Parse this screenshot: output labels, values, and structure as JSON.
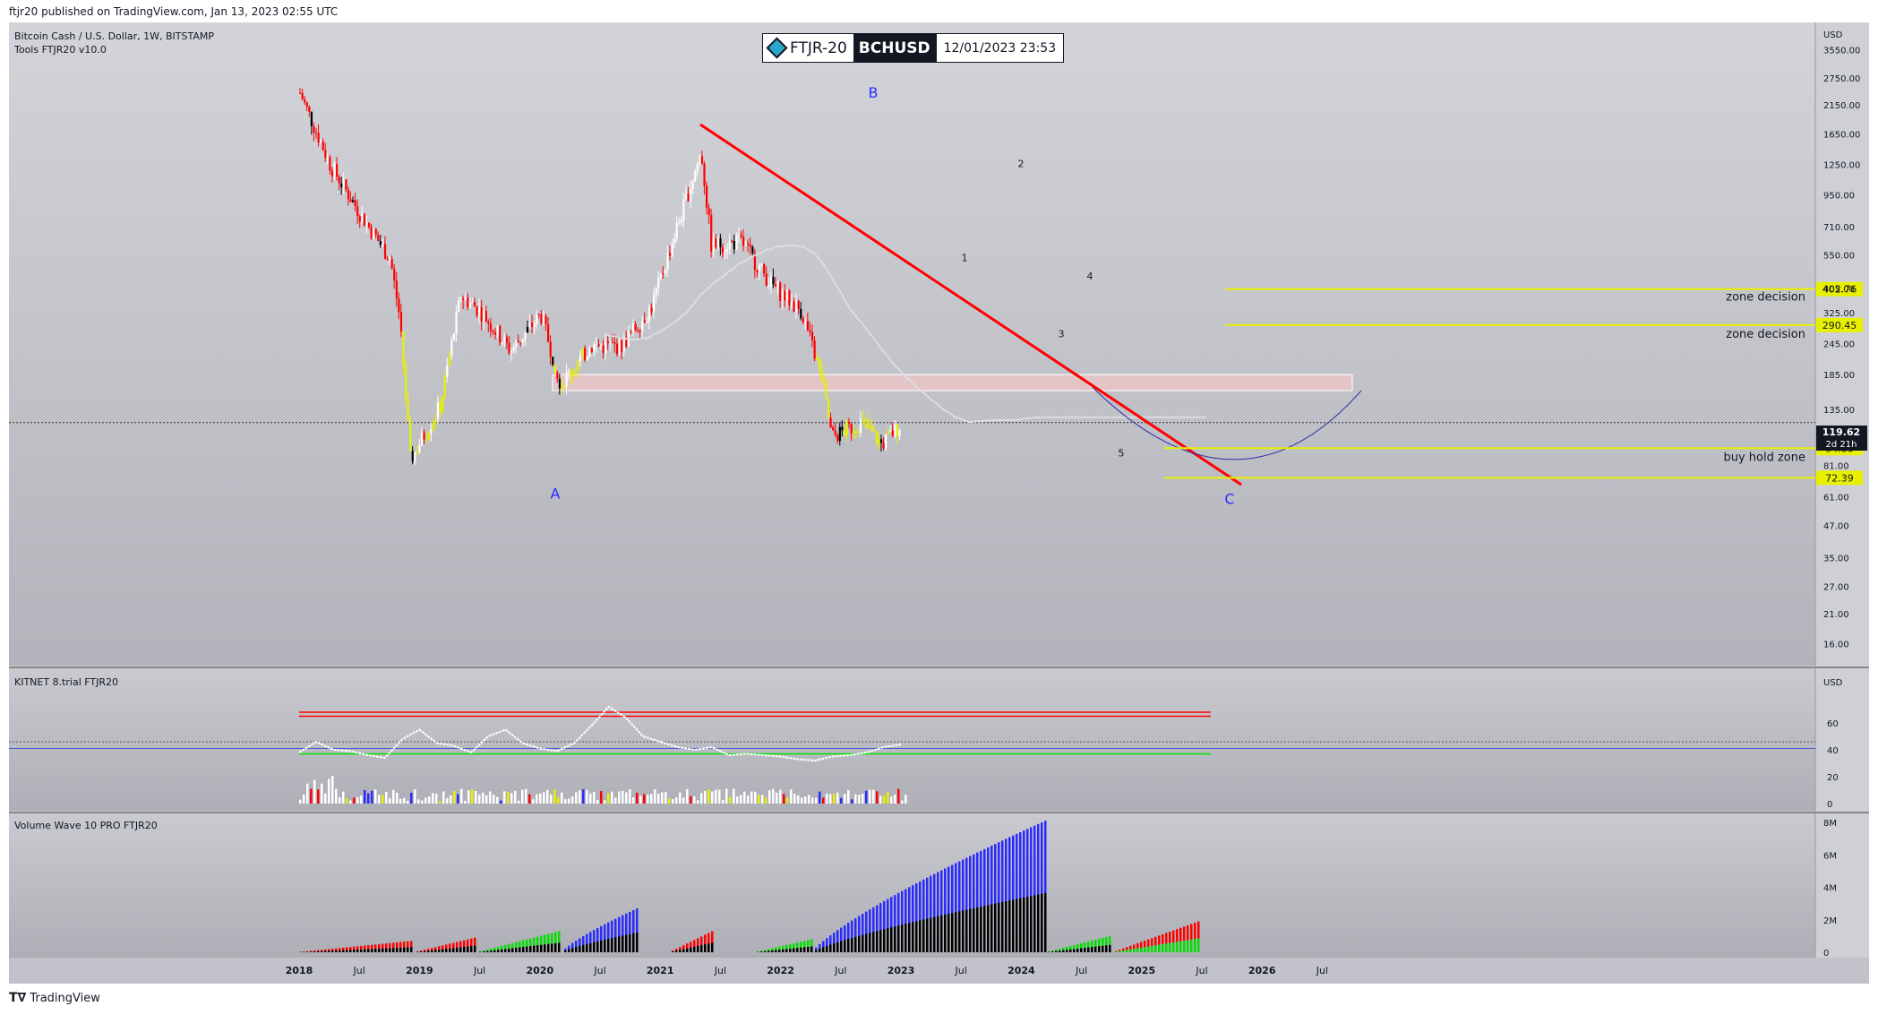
{
  "publish_line": "ftjr20 published on TradingView.com, Jan 13, 2023 02:55 UTC",
  "footer_brand": "TradingView",
  "badge": {
    "brand": "FTJR-20",
    "symbol": "BCHUSD",
    "datetime": "12/01/2023 23:53"
  },
  "main_pane": {
    "title_line1": "Bitcoin Cash / U.S. Dollar, 1W, BITSTAMP",
    "title_line2": "Tools  FTJR20  v10.0",
    "axis_currency": "USD",
    "price_tag": "119.62",
    "countdown": "2d 21h"
  },
  "osc_pane": {
    "title": "KITNET  8.trial  FTJR20",
    "axis_currency": "USD"
  },
  "vol_pane": {
    "title": "Volume Wave 10 PRO FTJR20"
  },
  "colors": {
    "bull": "#ffffff",
    "bear": "#ff0000",
    "yellow": "#e8f000",
    "blue": "#2a2aff",
    "green": "#00e000",
    "black": "#000000",
    "ma": "#dcdcdc",
    "trend": "#ff0000",
    "arc": "#2a2aaa"
  },
  "chart_data": [
    {
      "type": "candlestick",
      "scale": "log",
      "ylim": [
        14,
        4200
      ],
      "x_ticks": [
        "2018",
        "Jul",
        "2019",
        "Jul",
        "2020",
        "Jul",
        "2021",
        "Jul",
        "2022",
        "Jul",
        "2023",
        "Jul",
        "2024",
        "Jul",
        "2025",
        "Jul",
        "2026",
        "Jul"
      ],
      "y_ticks": [
        3550,
        2750,
        2150,
        1650,
        1250,
        950,
        710,
        550,
        405,
        325,
        245,
        185,
        135,
        81,
        61,
        47,
        35,
        27,
        21,
        16
      ],
      "last_price": 119.62,
      "x_range": [
        "2018-01",
        "2023-01"
      ],
      "price_path": [
        {
          "date": "2018-01",
          "price": 2400
        },
        {
          "date": "2018-04",
          "price": 1250
        },
        {
          "date": "2018-07",
          "price": 800
        },
        {
          "date": "2018-10",
          "price": 530
        },
        {
          "date": "2018-11",
          "price": 300
        },
        {
          "date": "2018-12",
          "price": 85
        },
        {
          "date": "2019-03",
          "price": 140
        },
        {
          "date": "2019-05",
          "price": 380
        },
        {
          "date": "2019-07",
          "price": 330
        },
        {
          "date": "2019-10",
          "price": 230
        },
        {
          "date": "2020-01",
          "price": 320
        },
        {
          "date": "2020-03",
          "price": 170
        },
        {
          "date": "2020-06",
          "price": 240
        },
        {
          "date": "2020-09",
          "price": 240
        },
        {
          "date": "2020-12",
          "price": 340
        },
        {
          "date": "2021-02",
          "price": 600
        },
        {
          "date": "2021-05",
          "price": 1400
        },
        {
          "date": "2021-06",
          "price": 600
        },
        {
          "date": "2021-09",
          "price": 620
        },
        {
          "date": "2021-12",
          "price": 420
        },
        {
          "date": "2022-03",
          "price": 330
        },
        {
          "date": "2022-05",
          "price": 180
        },
        {
          "date": "2022-06",
          "price": 105
        },
        {
          "date": "2022-09",
          "price": 120
        },
        {
          "date": "2022-11",
          "price": 98
        },
        {
          "date": "2023-01",
          "price": 119.62
        }
      ],
      "price_lines": [
        {
          "value": 402.76,
          "label": "zone decision"
        },
        {
          "value": 290.45,
          "label": "zone decision"
        },
        {
          "value": 94.8,
          "label": "buy hold zone"
        },
        {
          "value": 72.39,
          "label": ""
        }
      ],
      "annotations": [
        "A",
        "B",
        "C",
        "1",
        "2",
        "3",
        "4",
        "5"
      ]
    },
    {
      "type": "line",
      "y_ticks": [
        60,
        40,
        20,
        0
      ],
      "levels": [
        68,
        65,
        37
      ],
      "series": [
        {
          "values": [
            38,
            46,
            40,
            39,
            36,
            34,
            48,
            55,
            45,
            43,
            38,
            50,
            55,
            45,
            41,
            39,
            45,
            58,
            72,
            64,
            50,
            46,
            42,
            40,
            42,
            36,
            37,
            36,
            35,
            33,
            32,
            35,
            36,
            38,
            42,
            44
          ]
        }
      ]
    },
    {
      "type": "bar",
      "y_ticks": [
        "8M",
        "6M",
        "4M",
        "2M",
        "0"
      ]
    }
  ]
}
